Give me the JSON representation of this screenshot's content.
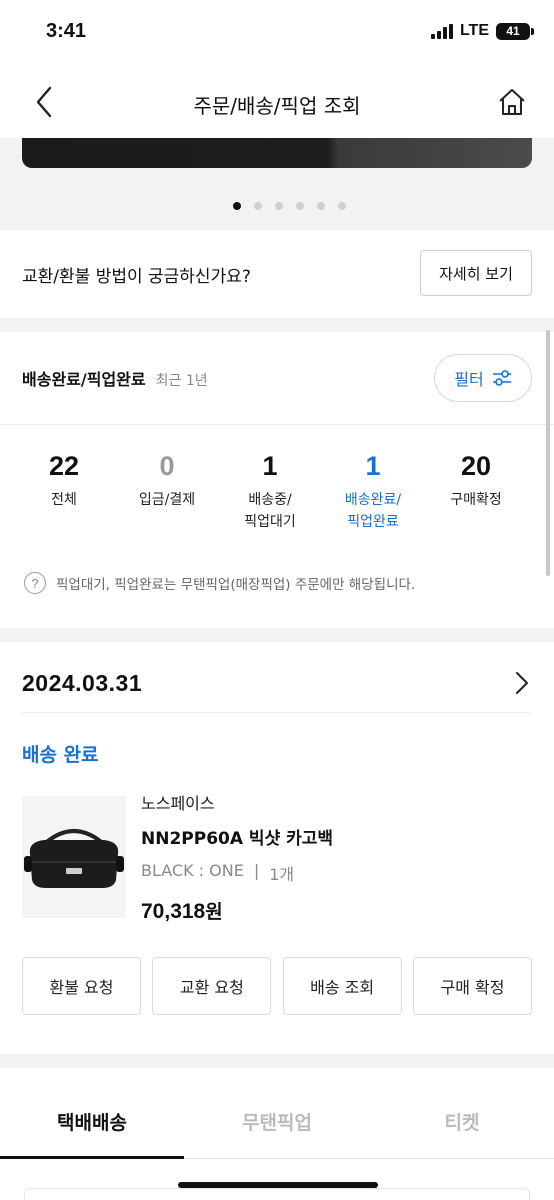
{
  "status_bar": {
    "time": "3:41",
    "network": "LTE",
    "battery": "41"
  },
  "header": {
    "title": "주문/배송/픽업 조회",
    "back_icon": "chevron-left-icon",
    "home_icon": "home-icon"
  },
  "banner": {
    "page_count": 6,
    "active_page": 1
  },
  "exchange_info": {
    "question": "교환/환불 방법이 궁금하신가요?",
    "detail_button": "자세히 보기"
  },
  "summary": {
    "title": "배송완료/픽업완료",
    "period": "최근 1년",
    "filter_button": "필터",
    "counts": [
      {
        "value": "22",
        "label_line1": "전체",
        "label_line2": ""
      },
      {
        "value": "0",
        "label_line1": "입금/결제",
        "label_line2": ""
      },
      {
        "value": "1",
        "label_line1": "배송중/",
        "label_line2": "픽업대기"
      },
      {
        "value": "1",
        "label_line1": "배송완료/",
        "label_line2": "픽업완료"
      },
      {
        "value": "20",
        "label_line1": "구매확정",
        "label_line2": ""
      }
    ],
    "notice": "픽업대기, 픽업완료는 무탠픽업(매장픽업) 주문에만 해당됩니다."
  },
  "order": {
    "date": "2024.03.31",
    "status": "배송 완료",
    "product": {
      "brand": "노스페이스",
      "name": "NN2PP60A 빅샷 카고백",
      "option": "BLACK : ONE",
      "separator": "|",
      "quantity": "1개",
      "price": "70,318",
      "currency": "원"
    },
    "actions": [
      "환불 요청",
      "교환 요청",
      "배송 조회",
      "구매 확정"
    ]
  },
  "tabs": [
    "택배배송",
    "무탠픽업",
    "티켓"
  ],
  "colors": {
    "accent": "#1a6fd1",
    "text": "#111111",
    "muted": "#888888",
    "background_gap": "#f2f2f2"
  }
}
